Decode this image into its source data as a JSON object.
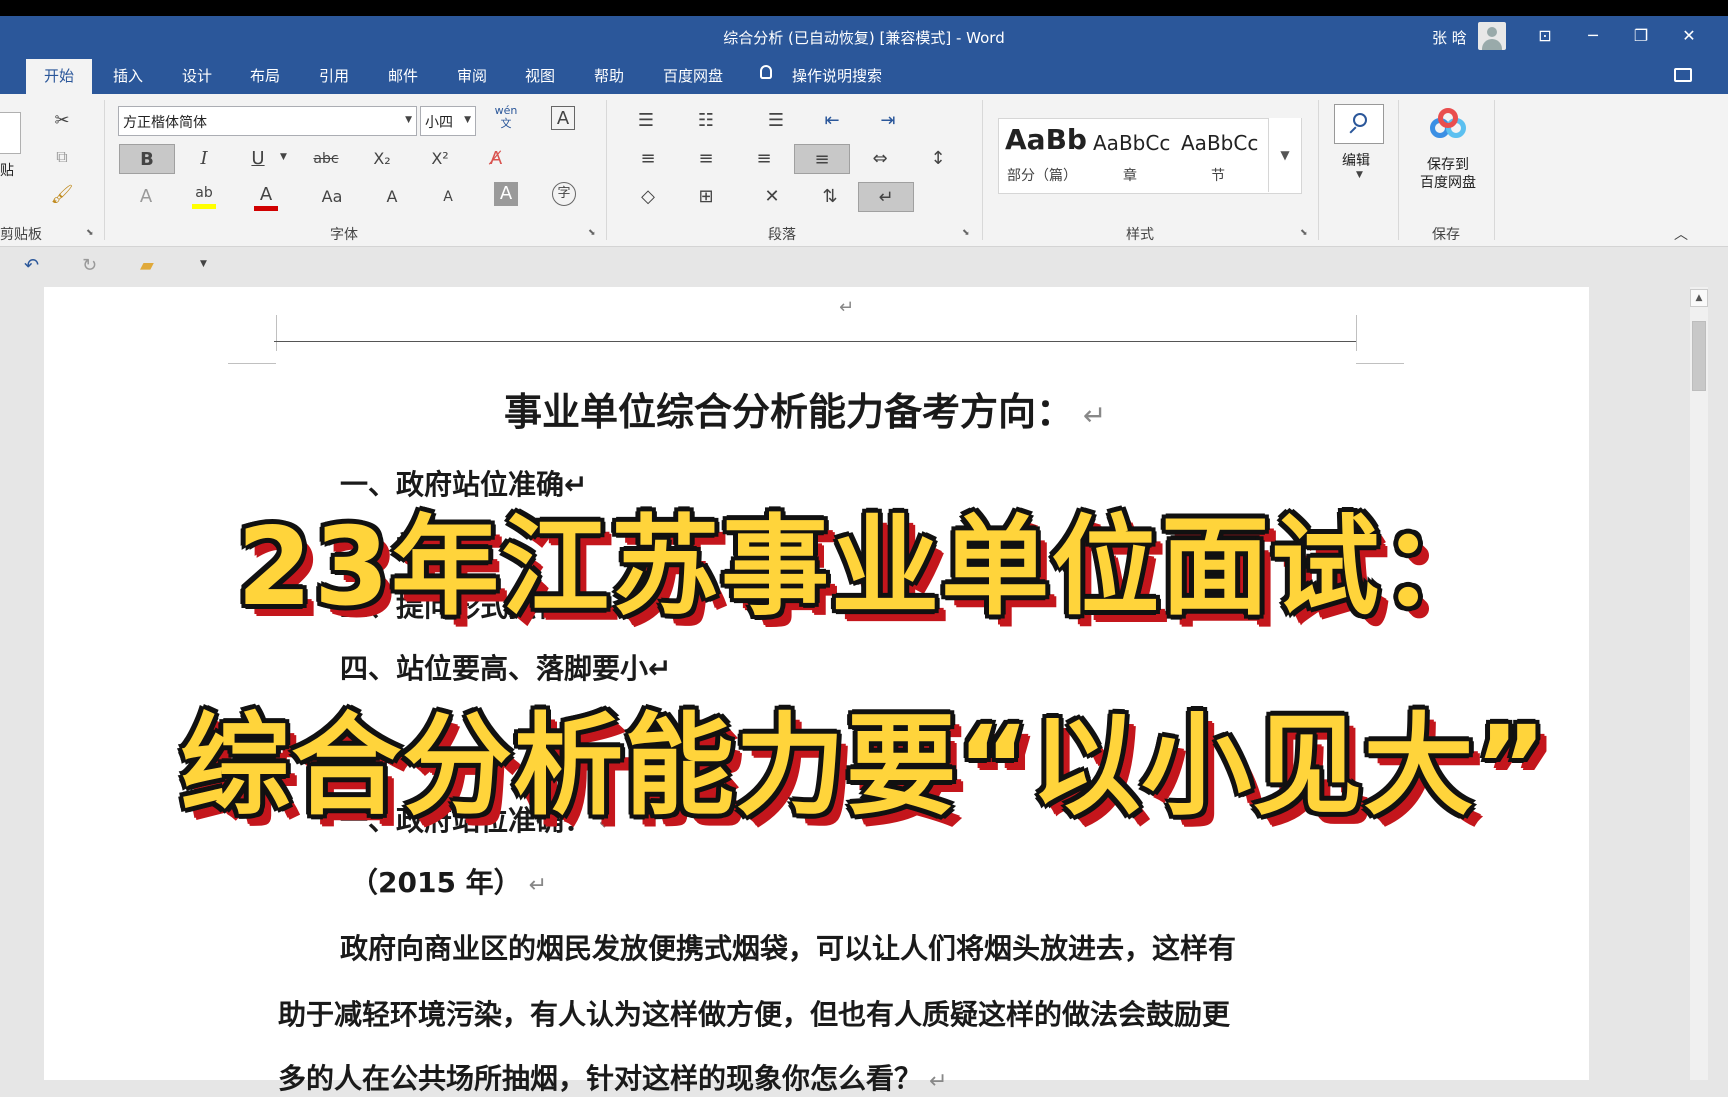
{
  "window": {
    "title": "综合分析 (已自动恢复) [兼容模式] - Word",
    "user_name": "张 晗"
  },
  "tabs": [
    {
      "label": "开始",
      "active": true
    },
    {
      "label": "插入"
    },
    {
      "label": "设计"
    },
    {
      "label": "布局"
    },
    {
      "label": "引用"
    },
    {
      "label": "邮件"
    },
    {
      "label": "审阅"
    },
    {
      "label": "视图"
    },
    {
      "label": "帮助"
    },
    {
      "label": "百度网盘"
    }
  ],
  "tell_me": "操作说明搜索",
  "ribbon": {
    "clipboard": {
      "paste_label": "贴",
      "group_label": "剪贴板"
    },
    "font": {
      "font_name": "方正楷体简体",
      "font_size": "小四",
      "group_label": "字体",
      "bold": "B",
      "italic": "I",
      "underline": "U",
      "strike": "abc",
      "subscript": "X₂",
      "superscript": "X²",
      "change_case": "Aa",
      "grow": "A",
      "shrink": "A",
      "phonetic": "wén\n文",
      "enclose": "字"
    },
    "paragraph": {
      "group_label": "段落"
    },
    "styles": {
      "group_label": "样式",
      "items": [
        {
          "preview": "AaBb",
          "name": "部分（篇）"
        },
        {
          "preview": "AaBbCc",
          "name": "章"
        },
        {
          "preview": "AaBbCc",
          "name": "节"
        }
      ]
    },
    "editing": {
      "label": "编辑"
    },
    "save": {
      "label_line1": "保存到",
      "label_line2": "百度网盘",
      "group_label": "保存"
    }
  },
  "document": {
    "header_mark": "↵",
    "title": "事业单位综合分析能力备考方向：",
    "lines": [
      "一、政府站位准确↵",
      "二、站",
      "三、提问形式独特↵",
      "四、站位要高、落脚要小↵",
      "一、政府站位准确：",
      "（2015 年）",
      "政府向商业区的烟民发放便携式烟袋，可以让人们将烟头放进去，这样有",
      "助于减轻环境污染，有人认为这样做方便，但也有人质疑这样的做法会鼓励更",
      "多的人在公共场所抽烟，针对这样的现象你怎么看？"
    ]
  },
  "overlay": {
    "line1": "23年江苏事业单位面试：",
    "line2": "综合分析能力要“以小见大”"
  },
  "colors": {
    "word_blue": "#2b579a",
    "overlay_fill": "#ffd43b",
    "overlay_shadow": "#c4161c"
  }
}
